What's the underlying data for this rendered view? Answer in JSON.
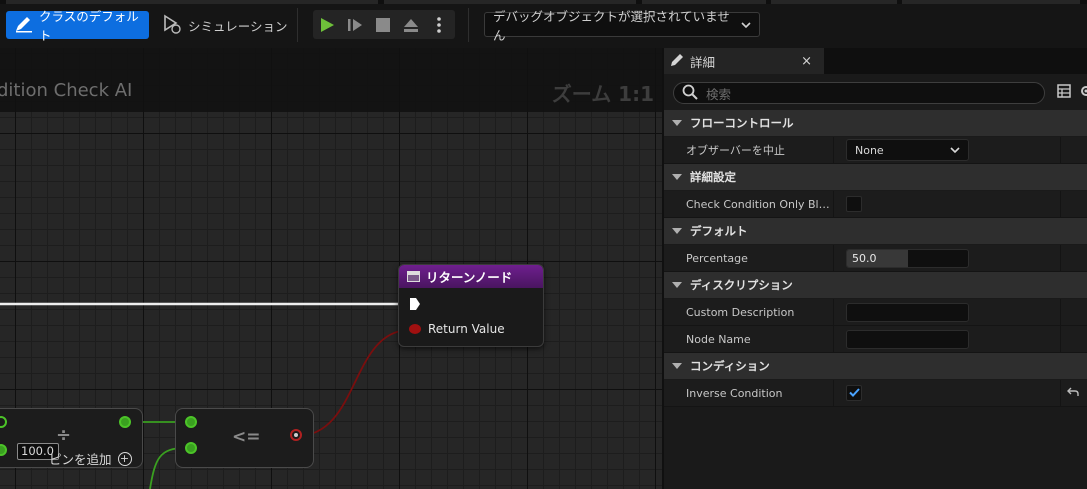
{
  "toolbar": {
    "class_defaults_label": "クラスのデフォルト",
    "simulation_label": "シミュレーション",
    "debug_object_label": "デバッグオブジェクトが選択されていません"
  },
  "graph": {
    "title": "dition Check AI",
    "zoom_label": "ズーム 1:1",
    "return_node": {
      "title": "リターンノード",
      "pin_label": "Return Value"
    },
    "compare_node": {
      "operator": "<="
    },
    "divide_node": {
      "operator": "÷",
      "input_value": "100.0",
      "add_pin_label": "ピンを追加"
    }
  },
  "details": {
    "tab_label": "詳細",
    "close_label": "×",
    "search_placeholder": "検索",
    "categories": [
      {
        "label": "フローコントロール",
        "rows": [
          {
            "name": "オブザーバーを中止",
            "value": "None"
          }
        ]
      },
      {
        "label": "詳細設定",
        "rows": [
          {
            "name": "Check Condition Only Blac…",
            "checked": false
          }
        ]
      },
      {
        "label": "デフォルト",
        "rows": [
          {
            "name": "Percentage",
            "value": "50.0"
          }
        ]
      },
      {
        "label": "ディスクリプション",
        "rows": [
          {
            "name": "Custom Description",
            "value": ""
          },
          {
            "name": "Node Name",
            "value": ""
          }
        ]
      },
      {
        "label": "コンディション",
        "rows": [
          {
            "name": "Inverse Condition",
            "checked": true
          }
        ]
      }
    ]
  },
  "colors": {
    "accent": "#0d6ee0",
    "play_green": "#6ec13a",
    "return_header": "#6e1f8e",
    "float_pin": "#4cc428",
    "bool_pin": "#b02020"
  }
}
